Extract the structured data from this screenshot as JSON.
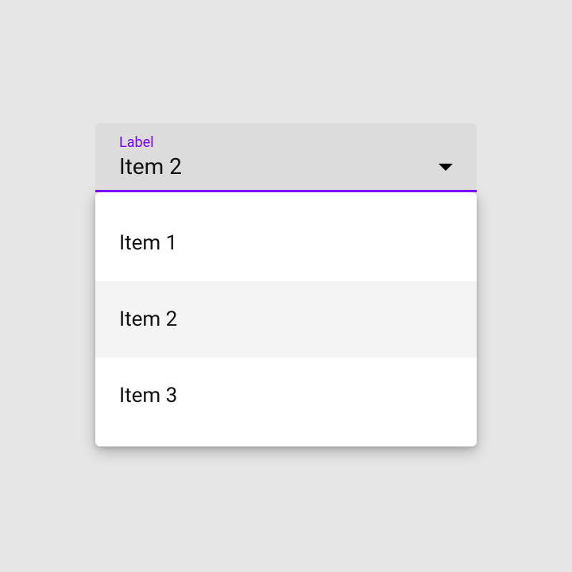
{
  "colors": {
    "accent": "#7b00ff"
  },
  "select": {
    "label": "Label",
    "value": "Item 2",
    "options": [
      {
        "label": "Item 1",
        "selected": false
      },
      {
        "label": "Item 2",
        "selected": true
      },
      {
        "label": "Item 3",
        "selected": false
      }
    ]
  }
}
